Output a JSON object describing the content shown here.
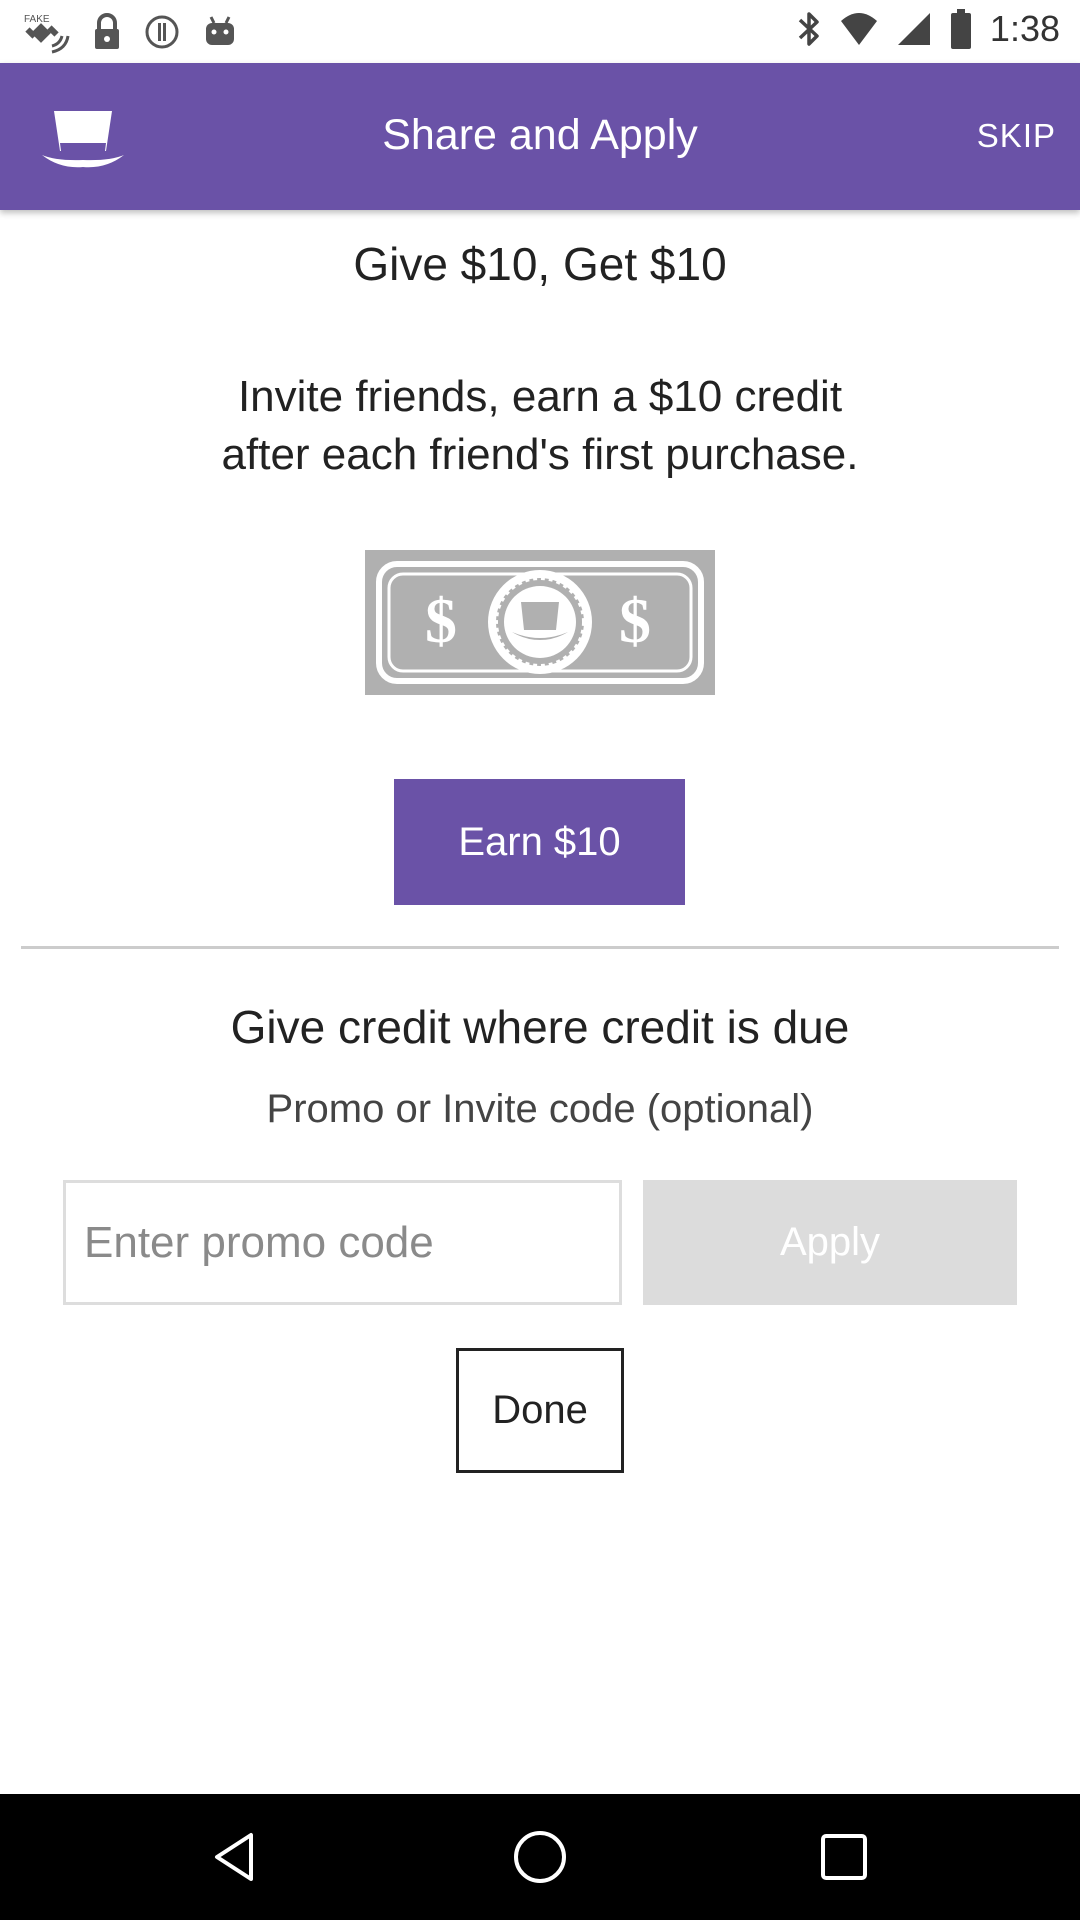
{
  "status_bar": {
    "time": "1:38",
    "left_icons": [
      "fake-gps-icon",
      "lock-icon",
      "info-circle-icon",
      "android-icon"
    ],
    "right_icons": [
      "bluetooth-icon"
    ]
  },
  "app_bar": {
    "logo_icon": "top-hat-icon",
    "title": "Share and Apply",
    "skip_label": "SKIP",
    "color": "#6a52a7"
  },
  "referral": {
    "headline": "Give $10, Get $10",
    "subtext_line1": "Invite friends, earn a $10 credit",
    "subtext_line2": "after each friend's first purchase.",
    "bill_icon": "dollar-bill-icon",
    "bill_symbol_left": "$",
    "bill_symbol_right": "$",
    "earn_button_label": "Earn $10"
  },
  "promo": {
    "section_title": "Give credit where credit is due",
    "label": "Promo or Invite code (optional)",
    "input_value": "",
    "input_placeholder": "Enter promo code",
    "apply_label": "Apply",
    "done_label": "Done"
  },
  "nav_bar": {
    "icons": [
      "back-triangle-icon",
      "home-circle-icon",
      "recents-square-icon"
    ]
  }
}
